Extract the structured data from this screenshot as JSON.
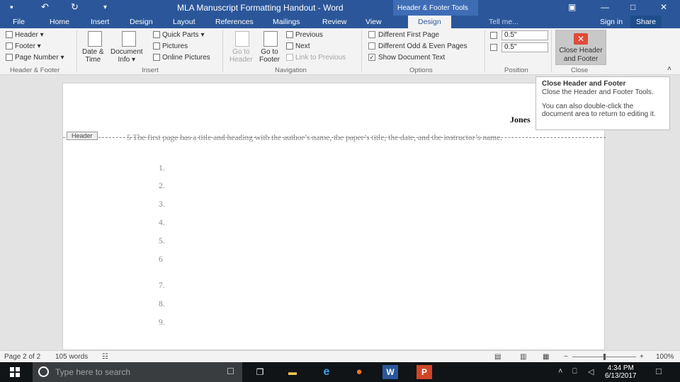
{
  "titlebar": {
    "doc_title": "MLA Manuscript Formatting Handout - Word",
    "context_title": "Header & Footer Tools",
    "save_glyph": "▪",
    "undo_glyph": "↶",
    "redo_glyph": "↻",
    "customize_glyph": "▾",
    "ribbon_display_glyph": "▣",
    "minimize_glyph": "—",
    "maximize_glyph": "□",
    "close_glyph": "✕"
  },
  "tabs": [
    {
      "label": "File"
    },
    {
      "label": "Home"
    },
    {
      "label": "Insert"
    },
    {
      "label": "Design"
    },
    {
      "label": "Layout"
    },
    {
      "label": "References"
    },
    {
      "label": "Mailings"
    },
    {
      "label": "Review"
    },
    {
      "label": "View"
    },
    {
      "label": "Design"
    }
  ],
  "tell_me": "Tell me...",
  "sign_in": "Sign in",
  "share": "Share",
  "ribbon": {
    "header_btn": "Header",
    "footer_btn": "Footer",
    "page_number_btn": "Page Number",
    "group_header_footer": "Header & Footer",
    "date_time_line1": "Date &",
    "date_time_line2": "Time",
    "doc_info_line1": "Document",
    "doc_info_line2": "Info",
    "quick_parts": "Quick Parts",
    "pictures": "Pictures",
    "online_pictures": "Online Pictures",
    "group_insert": "Insert",
    "goto_header_line1": "Go to",
    "goto_header_line2": "Header",
    "goto_footer_line1": "Go to",
    "goto_footer_line2": "Footer",
    "previous": "Previous",
    "next": "Next",
    "link_to_previous": "Link to Previous",
    "group_navigation": "Navigation",
    "diff_first_page": "Different First Page",
    "diff_odd_even": "Different Odd & Even Pages",
    "show_doc_text": "Show Document Text",
    "show_doc_text_check": "✓",
    "group_options": "Options",
    "header_pos_value": "0.5\"",
    "footer_pos_value": "0.5\"",
    "group_position": "Position",
    "close_hf_line1": "Close Header",
    "close_hf_line2": "and Footer",
    "close_glyph": "✕",
    "group_close": "Close",
    "collapse_glyph": "˄"
  },
  "tooltip": {
    "title": "Close Header and Footer",
    "body1": "Close the Header and Footer Tools.",
    "body2": "You can also double-click the document area to return to editing it."
  },
  "document": {
    "header_tag": "Header",
    "header_text": "Jones",
    "body_text": "5 The first page has a title and heading with the author’s name, the paper’s title, the date, and the instructor’s name.",
    "list_numbers": [
      "1.",
      "2.",
      "3.",
      "4.",
      "5.",
      "6",
      "7.",
      "8.",
      "9."
    ]
  },
  "statusbar": {
    "page": "Page 2 of 2",
    "words": "105 words",
    "proof_glyph": "☷",
    "view_read_glyph": "▤",
    "view_print_glyph": "▥",
    "view_web_glyph": "▦",
    "zoom_minus": "−",
    "zoom_plus": "+",
    "zoom": "100%",
    "zoom_level_percent": 100
  },
  "taskbar": {
    "search_placeholder": "Type here to search",
    "mic_glyph": "☐",
    "task_view_glyph": "❐",
    "explorer_glyph": "▬",
    "edge_glyph": "e",
    "firefox_glyph": "●",
    "word_glyph": "W",
    "powerpoint_glyph": "P",
    "tray_up_glyph": "˄",
    "network_glyph": "⎕",
    "volume_glyph": "◁",
    "time": "4:34 PM",
    "date": "6/13/2017",
    "notification_glyph": "□"
  },
  "colors": {
    "word_blue": "#2b579a",
    "close_red": "#e04a3a"
  }
}
